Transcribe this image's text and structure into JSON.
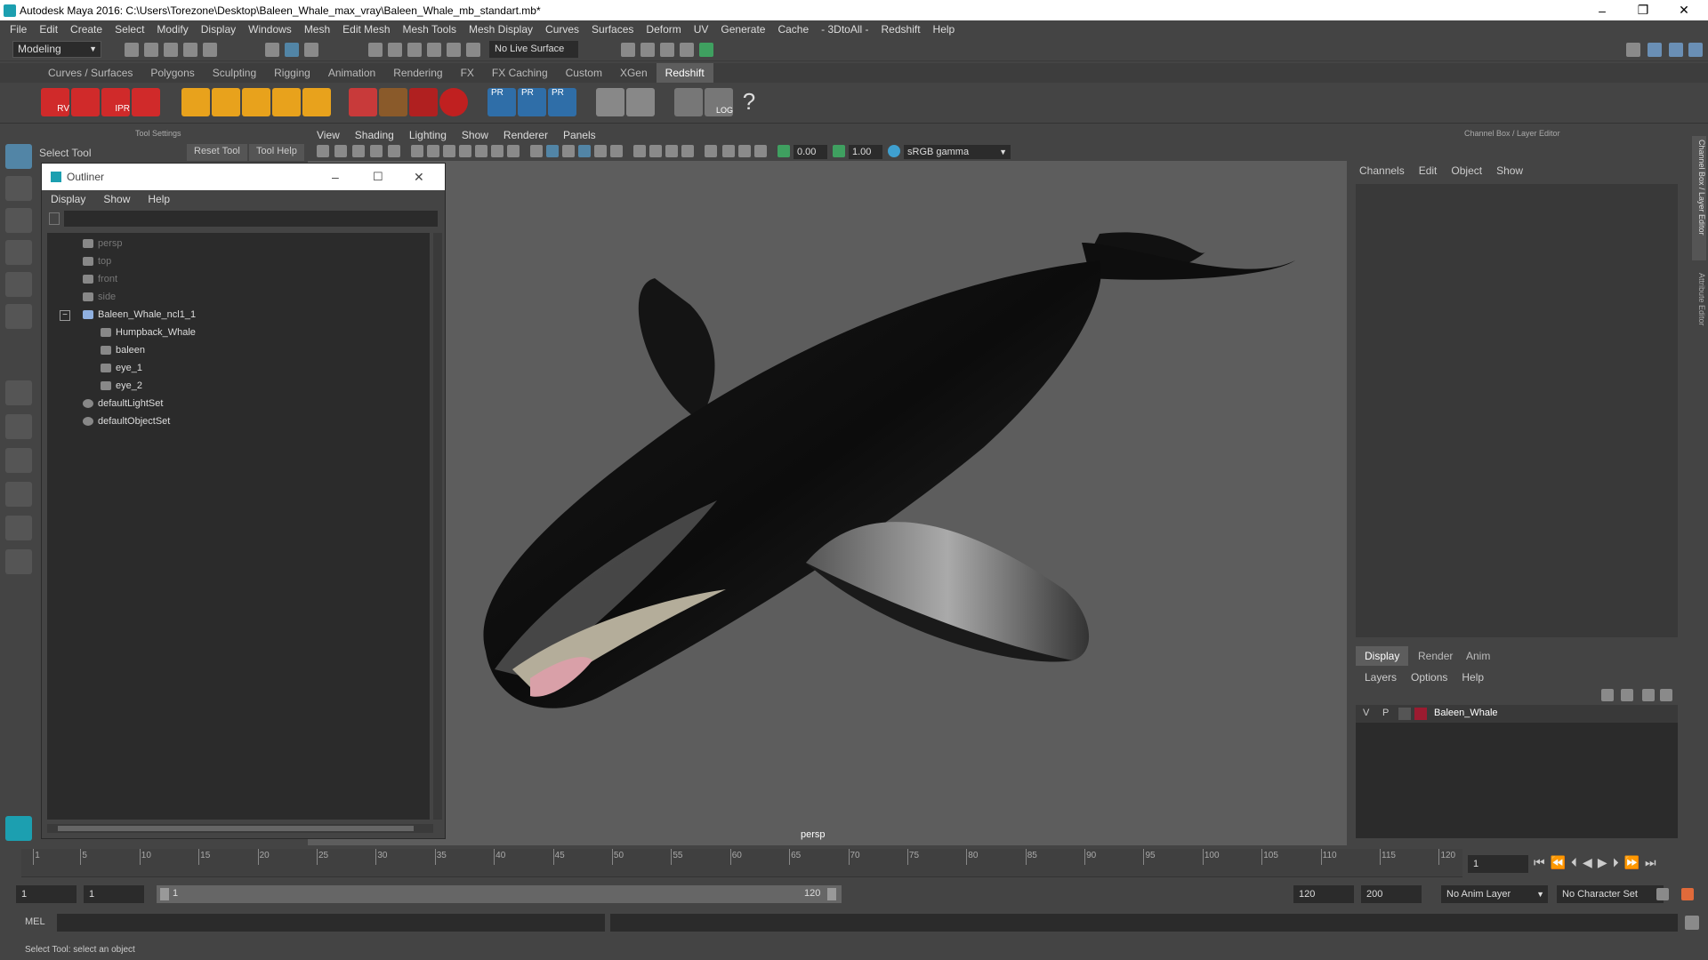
{
  "window": {
    "title": "Autodesk Maya 2016: C:\\Users\\Torezone\\Desktop\\Baleen_Whale_max_vray\\Baleen_Whale_mb_standart.mb*",
    "minimize": "–",
    "restore": "❐",
    "close": "✕"
  },
  "menubar": [
    "File",
    "Edit",
    "Create",
    "Select",
    "Modify",
    "Display",
    "Windows",
    "Mesh",
    "Edit Mesh",
    "Mesh Tools",
    "Mesh Display",
    "Curves",
    "Surfaces",
    "Deform",
    "UV",
    "Generate",
    "Cache",
    "- 3DtoAll -",
    "Redshift",
    "Help"
  ],
  "statusline": {
    "mode": "Modeling",
    "live_surface": "No Live Surface"
  },
  "shelf": {
    "tabs": [
      "Curves / Surfaces",
      "Polygons",
      "Sculpting",
      "Rigging",
      "Animation",
      "Rendering",
      "FX",
      "FX Caching",
      "Custom",
      "XGen",
      "Redshift"
    ],
    "active_tab": "Redshift",
    "icon_labels": [
      "RV",
      "IPR",
      "PR",
      "PR",
      "PR",
      "LOG",
      "?"
    ]
  },
  "tool_settings": {
    "title": "Tool Settings",
    "tool_name": "Select Tool",
    "reset": "Reset Tool",
    "help": "Tool Help"
  },
  "outliner": {
    "title": "Outliner",
    "menu": [
      "Display",
      "Show",
      "Help"
    ],
    "items": [
      {
        "label": "persp",
        "dim": true,
        "indent": 0
      },
      {
        "label": "top",
        "dim": true,
        "indent": 0
      },
      {
        "label": "front",
        "dim": true,
        "indent": 0
      },
      {
        "label": "side",
        "dim": true,
        "indent": 0
      },
      {
        "label": "Baleen_Whale_ncl1_1",
        "dim": false,
        "indent": 0,
        "expand": "−"
      },
      {
        "label": "Humpback_Whale",
        "dim": false,
        "indent": 1
      },
      {
        "label": "baleen",
        "dim": false,
        "indent": 1
      },
      {
        "label": "eye_1",
        "dim": false,
        "indent": 1
      },
      {
        "label": "eye_2",
        "dim": false,
        "indent": 1
      },
      {
        "label": "defaultLightSet",
        "dim": false,
        "indent": 0
      },
      {
        "label": "defaultObjectSet",
        "dim": false,
        "indent": 0
      }
    ]
  },
  "viewport": {
    "menu": [
      "View",
      "Shading",
      "Lighting",
      "Show",
      "Renderer",
      "Panels"
    ],
    "exposure": "0.00",
    "gamma": "1.00",
    "colorspace": "sRGB gamma",
    "camera_label": "persp"
  },
  "channel_box": {
    "title": "Channel Box / Layer Editor",
    "menu": [
      "Channels",
      "Edit",
      "Object",
      "Show"
    ],
    "layer_tabs": [
      "Display",
      "Render",
      "Anim"
    ],
    "layer_menu": [
      "Layers",
      "Options",
      "Help"
    ],
    "layer": {
      "v": "V",
      "p": "P",
      "name": "Baleen_Whale",
      "color": "#9b1b30"
    },
    "side_tabs": [
      "Channel Box / Layer Editor",
      "Attribute Editor"
    ]
  },
  "timeline": {
    "ticks": [
      1,
      5,
      10,
      15,
      20,
      25,
      30,
      35,
      40,
      45,
      50,
      55,
      60,
      65,
      70,
      75,
      80,
      85,
      90,
      95,
      100,
      105,
      110,
      115,
      120
    ],
    "current_frame": "1"
  },
  "range": {
    "start": "1",
    "playback_start": "1",
    "slider_start": "1",
    "slider_end": "120",
    "playback_end": "120",
    "end": "200",
    "anim_layer": "No Anim Layer",
    "char_set": "No Character Set"
  },
  "command": {
    "lang": "MEL"
  },
  "help_line": "Select Tool: select an object"
}
